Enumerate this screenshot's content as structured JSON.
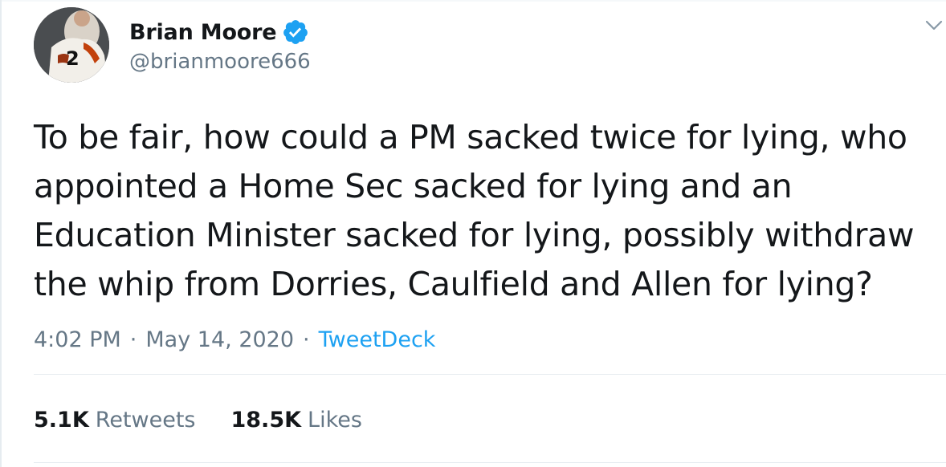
{
  "author": {
    "display_name": "Brian Moore",
    "handle": "@brianmoore666",
    "verified": true,
    "avatar_jersey_number": "2"
  },
  "tweet": {
    "text": "To be fair, how could a PM sacked twice for lying, who appointed a Home Sec sacked for lying and an Education Minister sacked for lying, possibly withdraw the whip from Dorries, Caulfield and Allen for lying?",
    "time": "4:02 PM",
    "date": "May 14, 2020",
    "separator": "·",
    "source": "TweetDeck"
  },
  "stats": {
    "retweets_count": "5.1K",
    "retweets_label": "Retweets",
    "likes_count": "18.5K",
    "likes_label": "Likes"
  },
  "icons": {
    "verified": "verified-badge-icon",
    "caret": "chevron-down-icon"
  },
  "colors": {
    "accent": "#1da1f2",
    "text": "#14171a",
    "secondary": "#657786",
    "border": "#e6ecf0"
  }
}
